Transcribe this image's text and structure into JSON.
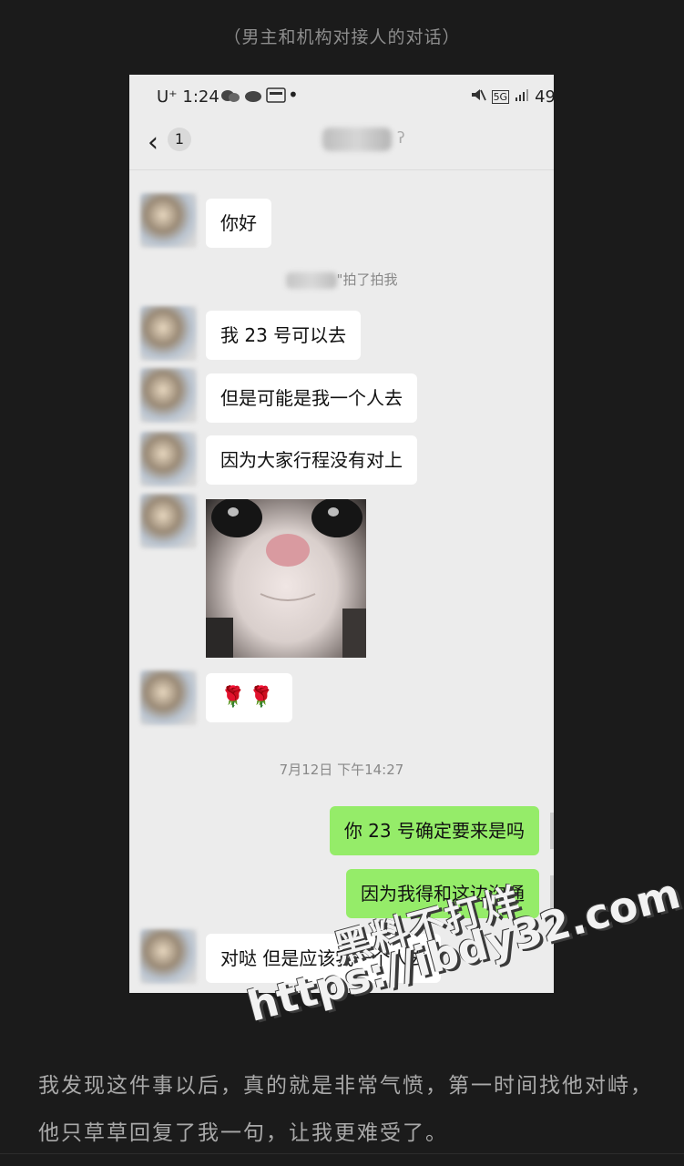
{
  "caption": "（男主和机构对接人的对话）",
  "status_bar": {
    "carrier": "U⁺ 1:24",
    "network": "5G",
    "battery": "49"
  },
  "nav": {
    "back_glyph": "‹",
    "unread_count": "1",
    "ear_glyph": "ʔ"
  },
  "messages": [
    {
      "from": "other",
      "text": "你好"
    },
    {
      "type": "system",
      "text": "\"拍了拍我"
    },
    {
      "from": "other",
      "text": "我 23 号可以去"
    },
    {
      "from": "other",
      "text": "但是可能是我一个人去"
    },
    {
      "from": "other",
      "text": "因为大家行程没有对上"
    },
    {
      "from": "other",
      "type": "image",
      "icon": "cat-photo"
    },
    {
      "from": "other",
      "text": "🌹🌹"
    },
    {
      "type": "timestamp",
      "text": "7月12日 下午14:27"
    },
    {
      "from": "me",
      "text": "你 23 号确定要来是吗"
    },
    {
      "from": "me",
      "text": "因为我得和这边沟通"
    },
    {
      "from": "other",
      "text": "对哒 但是应该我一个人去"
    }
  ],
  "watermark": {
    "cn": "黑料不打烊",
    "url": "https://ibdy32.com"
  },
  "article": {
    "paragraph": "我发现这件事以后，真的就是非常气愤，第一时间找他对峙，他只草草回复了我一句，让我更难受了。"
  }
}
